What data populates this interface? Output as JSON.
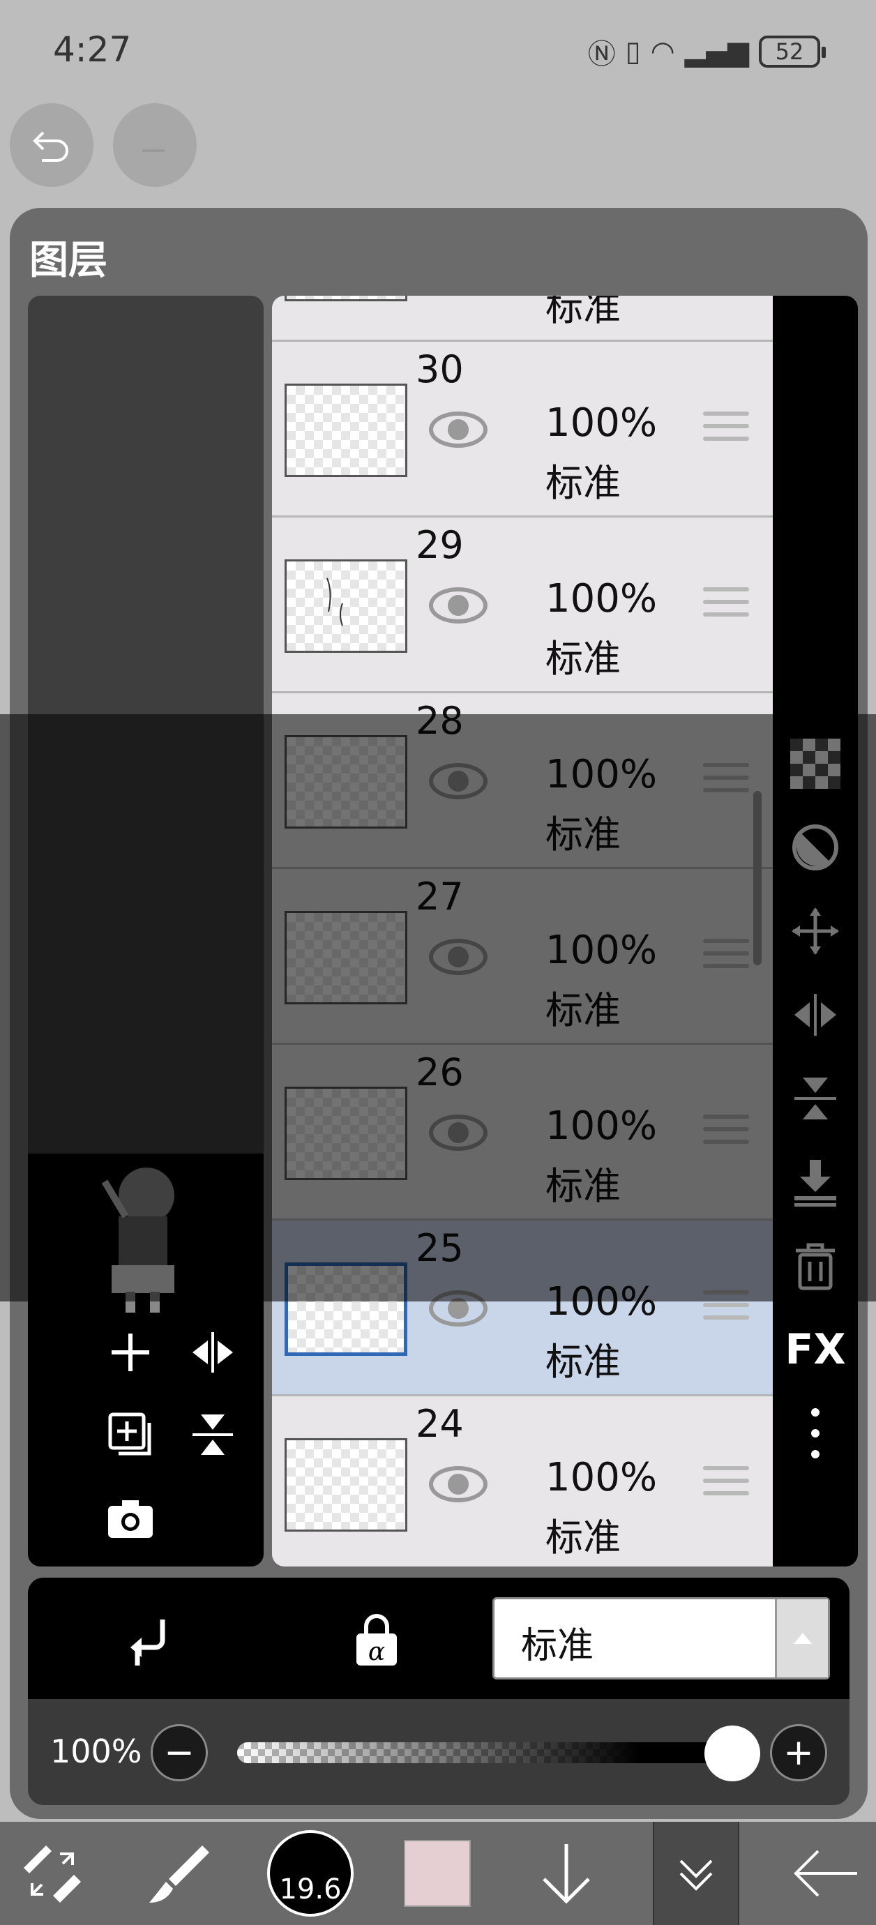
{
  "status_bar": {
    "time": "4:27",
    "battery": "52"
  },
  "panel": {
    "title": "图层"
  },
  "layers": [
    {
      "number": "",
      "opacity": "",
      "blend": "标准",
      "selected": false
    },
    {
      "number": "30",
      "opacity": "100%",
      "blend": "标准",
      "selected": false
    },
    {
      "number": "29",
      "opacity": "100%",
      "blend": "标准",
      "selected": false
    },
    {
      "number": "28",
      "opacity": "100%",
      "blend": "标准",
      "selected": false
    },
    {
      "number": "27",
      "opacity": "100%",
      "blend": "标准",
      "selected": false
    },
    {
      "number": "26",
      "opacity": "100%",
      "blend": "标准",
      "selected": false
    },
    {
      "number": "25",
      "opacity": "100%",
      "blend": "标准",
      "selected": true
    },
    {
      "number": "24",
      "opacity": "100%",
      "blend": "标准",
      "selected": false
    }
  ],
  "right_toolbar": {
    "fx_label": "FX"
  },
  "blend_bar": {
    "blend_mode": "标准"
  },
  "opacity_bar": {
    "label": "100%",
    "minus": "−",
    "plus": "+",
    "value_percent": 100
  },
  "app_toolbar": {
    "brush_size": "19.6",
    "color": "#e6cfd2"
  },
  "icons": {
    "undo": "undo-icon",
    "redo": "redo-icon",
    "add": "add-icon",
    "flip-h": "flip-horizontal-icon",
    "copy": "duplicate-layer-icon",
    "flip-v": "flip-vertical-icon",
    "camera": "camera-icon",
    "checker": "transparency-icon",
    "circle": "circle-mask-icon",
    "move": "move-icon",
    "merge-down": "merge-down-icon",
    "trash": "trash-icon",
    "more": "more-vertical-icon",
    "clip": "clipping-icon",
    "alpha-lock": "alpha-lock-icon"
  }
}
